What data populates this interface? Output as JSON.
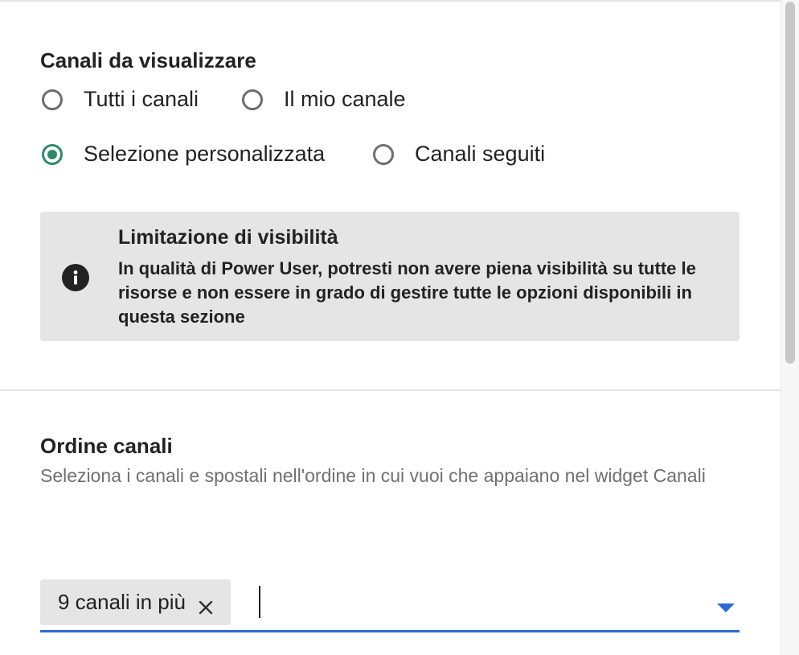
{
  "channels_section": {
    "title": "Canali da visualizzare",
    "options": [
      {
        "label": "Tutti i canali",
        "checked": false
      },
      {
        "label": "Il mio canale",
        "checked": false
      },
      {
        "label": "Selezione personalizzata",
        "checked": true
      },
      {
        "label": "Canali seguiti",
        "checked": false
      }
    ],
    "accent_color": "#2e8a68"
  },
  "info_notice": {
    "icon": "info-icon",
    "title": "Limitazione di visibilità",
    "text": "In qualità di Power User, potresti non avere piena visibilità su tutte le risorse e non essere in grado di gestire tutte le opzioni disponibili in questa sezione"
  },
  "order_section": {
    "title": "Ordine canali",
    "description": "Seleziona i canali e spostali nell'ordine in cui vuoi che appaiano nel widget Canali",
    "chip_label": "9 canali in più",
    "input_value": "",
    "underline_color": "#2d68d6"
  }
}
